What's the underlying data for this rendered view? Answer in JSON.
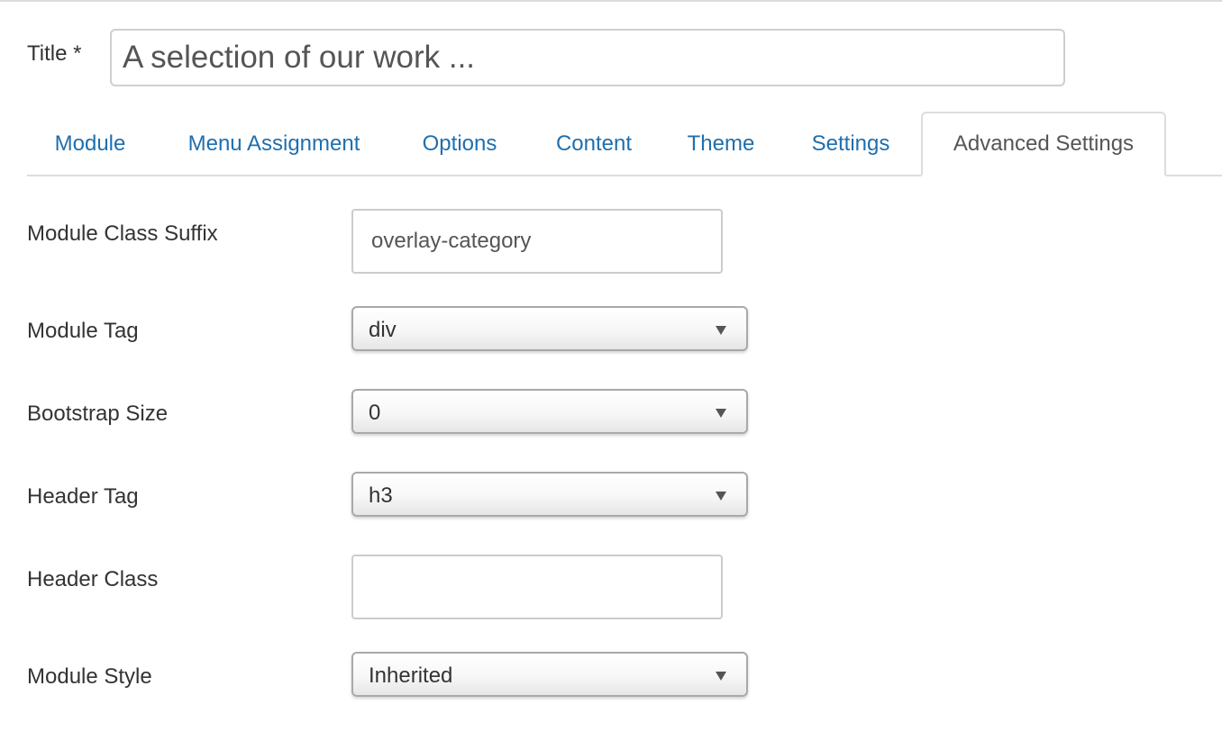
{
  "title_field": {
    "label": "Title *",
    "value": "A selection of our work ..."
  },
  "tabs": [
    {
      "label": "Module",
      "active": false
    },
    {
      "label": "Menu Assignment",
      "active": false
    },
    {
      "label": "Options",
      "active": false
    },
    {
      "label": "Content",
      "active": false
    },
    {
      "label": "Theme",
      "active": false
    },
    {
      "label": "Settings",
      "active": false
    },
    {
      "label": "Advanced Settings",
      "active": true
    }
  ],
  "fields": {
    "module_class_suffix": {
      "label": "Module Class Suffix",
      "value": "overlay-category"
    },
    "module_tag": {
      "label": "Module Tag",
      "value": "div"
    },
    "bootstrap_size": {
      "label": "Bootstrap Size",
      "value": "0"
    },
    "header_tag": {
      "label": "Header Tag",
      "value": "h3"
    },
    "header_class": {
      "label": "Header Class",
      "value": ""
    },
    "module_style": {
      "label": "Module Style",
      "value": "Inherited"
    }
  },
  "colors": {
    "link": "#1f6fae",
    "active_tab_text": "#555555",
    "border": "#dddddd"
  }
}
